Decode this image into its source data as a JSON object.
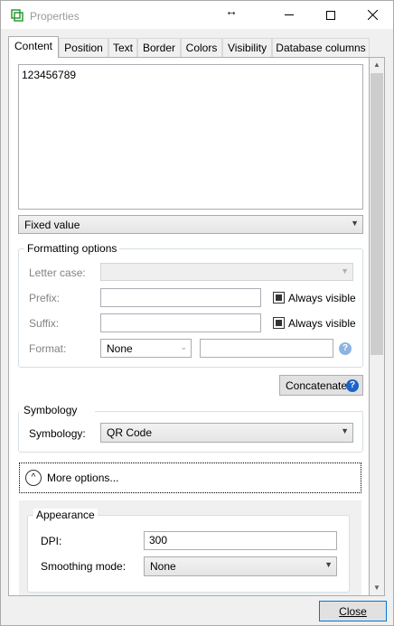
{
  "window": {
    "title": "Properties",
    "close_label": "Close"
  },
  "tabs": [
    {
      "label": "Content",
      "active": true
    },
    {
      "label": "Position",
      "active": false
    },
    {
      "label": "Text",
      "active": false
    },
    {
      "label": "Border",
      "active": false
    },
    {
      "label": "Colors",
      "active": false
    },
    {
      "label": "Visibility",
      "active": false
    },
    {
      "label": "Database columns",
      "active": false
    }
  ],
  "content": {
    "value_text": "123456789",
    "value_source": "Fixed value"
  },
  "formatting": {
    "legend": "Formatting options",
    "letter_case_label": "Letter case:",
    "letter_case_value": "",
    "prefix_label": "Prefix:",
    "prefix_value": "",
    "prefix_always_visible": "Always visible",
    "suffix_label": "Suffix:",
    "suffix_value": "",
    "suffix_always_visible": "Always visible",
    "format_label": "Format:",
    "format_value": "None",
    "format_text": ""
  },
  "concatenate_label": "Concatenate",
  "symbology": {
    "legend": "Symbology",
    "label": "Symbology:",
    "value": "QR Code"
  },
  "more_options_label": "More options...",
  "appearance": {
    "legend": "Appearance",
    "dpi_label": "DPI:",
    "dpi_value": "300",
    "smoothing_label": "Smoothing mode:",
    "smoothing_value": "None"
  },
  "icons": {
    "app": "app-logo-icon",
    "resize": "horizontal-resize-icon",
    "help": "question-mark-icon"
  },
  "colors": {
    "accent": "#0078d7",
    "help_blue": "#1c64c8",
    "app_green": "#2e9a3a"
  }
}
